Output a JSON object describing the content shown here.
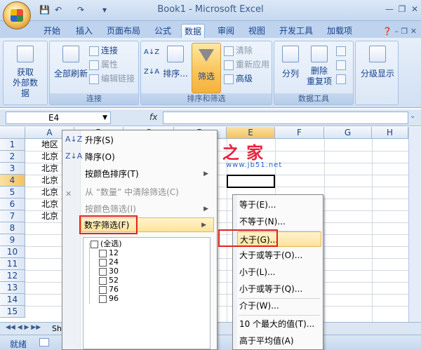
{
  "window": {
    "title": "Book1 - Microsoft Excel"
  },
  "ribbon_tabs": [
    "开始",
    "插入",
    "页面布局",
    "公式",
    "数据",
    "审阅",
    "视图",
    "开发工具",
    "加载项"
  ],
  "active_tab": "数据",
  "ribbon": {
    "get_external": "获取\n外部数据",
    "refresh_all": "全部刷新",
    "connections": "连接",
    "properties": "属性",
    "edit_links": "编辑链接",
    "group_connections": "连接",
    "sort_asc_icon": "A↓Z",
    "sort_desc_icon": "Z↓A",
    "sort": "排序...",
    "filter": "筛选",
    "clear": "清除",
    "reapply": "重新应用",
    "advanced": "高级",
    "group_sort_filter": "排序和筛选",
    "split": "分列",
    "remove_dup": "删除\n重复项",
    "group_data_tools": "数据工具",
    "outline": "分级显示"
  },
  "formula_bar": {
    "name_box": "E4",
    "fx": "fx"
  },
  "columns": [
    "A",
    "B",
    "C",
    "D",
    "E",
    "F",
    "G",
    "H"
  ],
  "rows": [
    "1",
    "2",
    "3",
    "4",
    "5",
    "6",
    "7",
    "8",
    "9",
    "10",
    "11",
    "12",
    "13",
    "14",
    "15"
  ],
  "cells_A": [
    "地区",
    "北京",
    "北京",
    "北京",
    "北京",
    "北京",
    "北京"
  ],
  "sheet_tab": "Sh",
  "status": "就绪",
  "watermark": {
    "text": "脚 本 之 家",
    "url": "www.jb51.net"
  },
  "filter_menu": {
    "sort_asc": "升序(S)",
    "sort_desc": "降序(O)",
    "sort_color": "按颜色排序(T)",
    "clear_filter": "从 “数量” 中清除筛选(C)",
    "filter_color": "按颜色筛选(I)",
    "number_filter": "数字筛选(F)",
    "checklist": [
      "(全选)",
      "12",
      "24",
      "30",
      "52",
      "76",
      "96"
    ]
  },
  "number_filter_submenu": [
    "等于(E)...",
    "不等于(N)...",
    "大于(G)...",
    "大于或等于(O)...",
    "小于(L)...",
    "小于或等于(Q)...",
    "介于(W)...",
    "10 个最大的值(T)...",
    "高于平均值(A)"
  ]
}
